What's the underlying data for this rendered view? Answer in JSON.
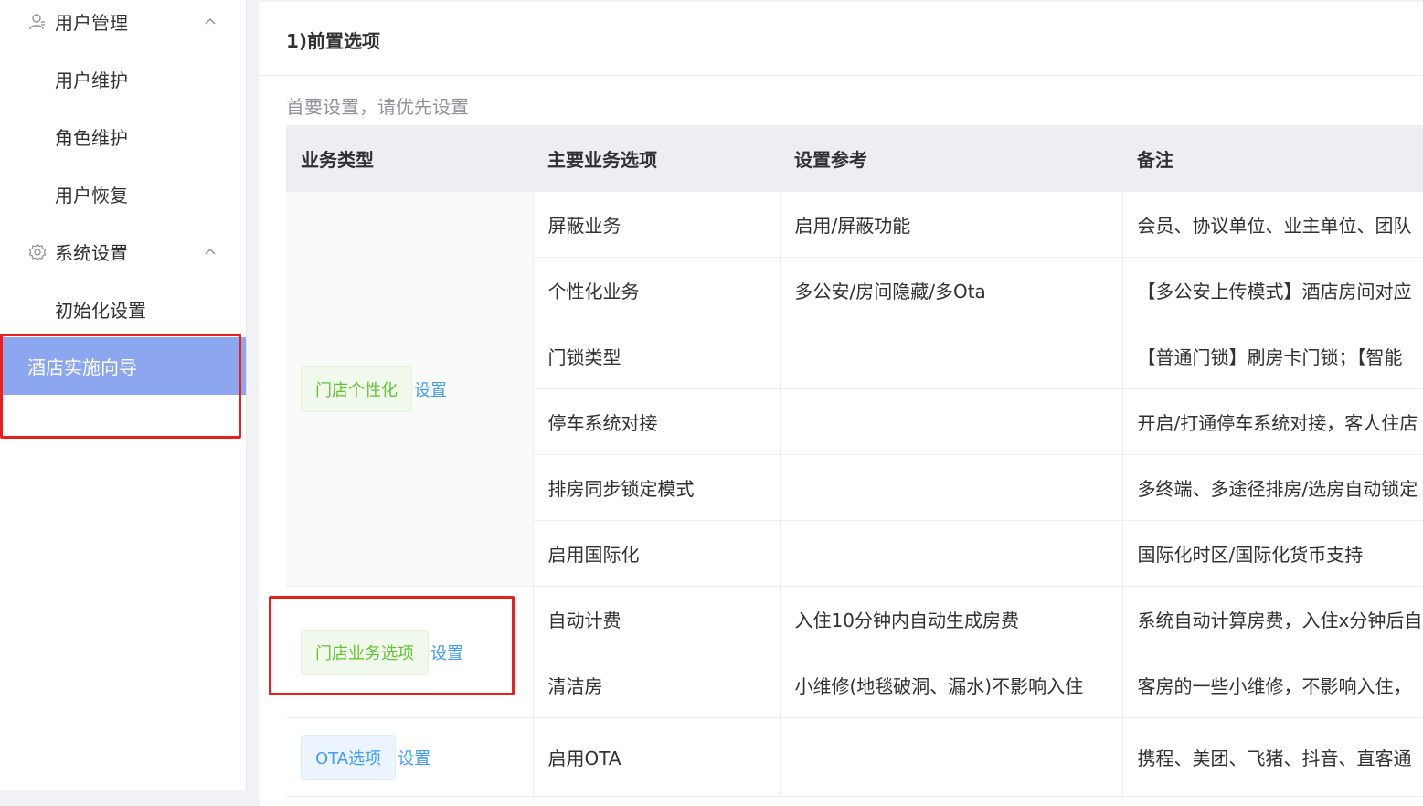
{
  "sidebar": {
    "groups": [
      {
        "label": "用户管理",
        "icon": "user-icon",
        "items": [
          "用户维护",
          "角色维护",
          "用户恢复"
        ]
      },
      {
        "label": "系统设置",
        "icon": "gear-icon",
        "items": [
          "初始化设置"
        ]
      }
    ],
    "active_item": "酒店实施向导"
  },
  "main": {
    "title": "1)前置选项",
    "subtitle": "首要设置，请优先设置",
    "table": {
      "headers": [
        "业务类型",
        "主要业务选项",
        "设置参考",
        "备注"
      ],
      "groups": [
        {
          "tag": "门店个性化",
          "tag_color": "green",
          "link": "设置",
          "rows": [
            {
              "option": "屏蔽业务",
              "ref": "启用/屏蔽功能",
              "note": "会员、协议单位、业主单位、团队"
            },
            {
              "option": "个性化业务",
              "ref": "多公安/房间隐藏/多Ota",
              "note": "【多公安上传模式】酒店房间对应"
            },
            {
              "option": "门锁类型",
              "ref": "",
              "note": "【普通门锁】刷房卡门锁；【智能"
            },
            {
              "option": "停车系统对接",
              "ref": "",
              "note": "开启/打通停车系统对接，客人住店"
            },
            {
              "option": "排房同步锁定模式",
              "ref": "",
              "note": "多终端、多途径排房/选房自动锁定"
            },
            {
              "option": "启用国际化",
              "ref": "",
              "note": "国际化时区/国际化货币支持"
            }
          ]
        },
        {
          "tag": "门店业务选项",
          "tag_color": "green",
          "link": "设置",
          "rows": [
            {
              "option": "自动计费",
              "ref": "入住10分钟内自动生成房费",
              "note": "系统自动计算房费，入住x分钟后自"
            },
            {
              "option": "清洁房",
              "ref": "小维修(地毯破洞、漏水)不影响入住",
              "note": "客房的一些小维修，不影响入住，"
            }
          ]
        },
        {
          "tag": "OTA选项",
          "tag_color": "blue",
          "link": "设置",
          "rows": [
            {
              "option": "启用OTA",
              "ref": "",
              "note": "携程、美团、飞猪、抖音、直客通"
            }
          ]
        }
      ]
    }
  },
  "colors": {
    "active_bg": "#8ca6f0",
    "highlight_red": "#e8201c",
    "link_blue": "#409eff",
    "tag_green": "#67c23a"
  }
}
